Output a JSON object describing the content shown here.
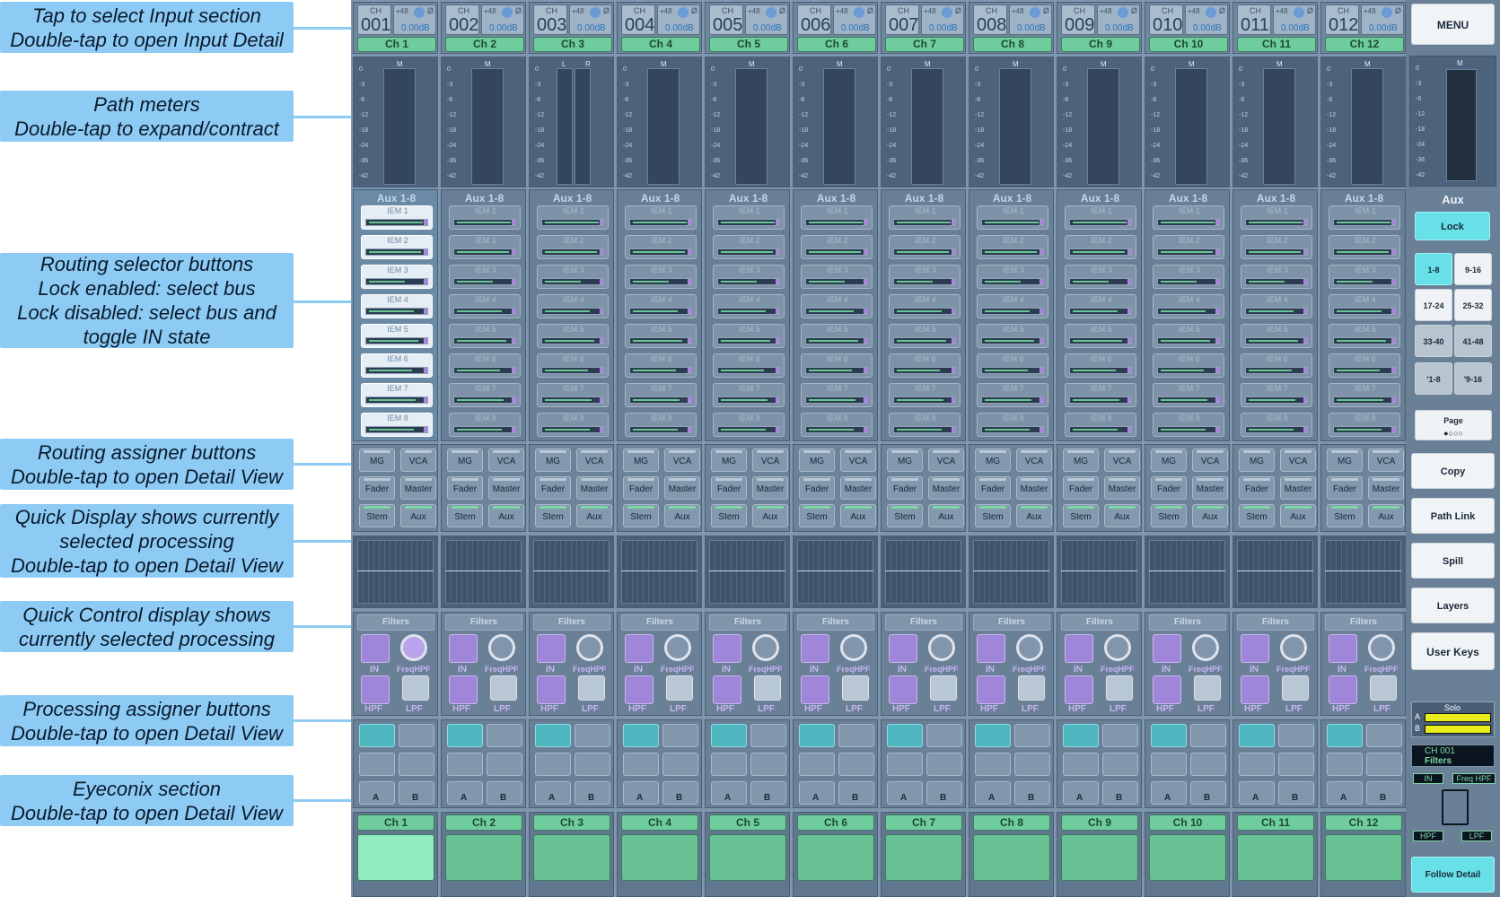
{
  "callouts": [
    {
      "lines": [
        "Tap to select Input section",
        "Double-tap to open Input Detail"
      ]
    },
    {
      "lines": [
        "Path meters",
        "Double-tap to expand/contract"
      ]
    },
    {
      "lines": [
        "Routing selector buttons",
        "Lock enabled: select bus",
        "Lock disabled: select bus and",
        "toggle IN state"
      ]
    },
    {
      "lines": [
        "Routing assigner buttons",
        "Double-tap to open Detail View"
      ]
    },
    {
      "lines": [
        "Quick Display shows currently",
        "selected processing",
        "Double-tap to open Detail View"
      ]
    },
    {
      "lines": [
        "Quick Control display shows",
        "currently selected processing"
      ]
    },
    {
      "lines": [
        "Processing assigner buttons",
        "Double-tap to open Detail View"
      ]
    },
    {
      "lines": [
        "Eyeconix section",
        "Double-tap to open Detail View"
      ]
    }
  ],
  "strip_common": {
    "ch_label": "CH",
    "p48": "+48",
    "phase": "Ø",
    "gain": "0.00dB",
    "meter_mono": "M",
    "meter_l": "L",
    "meter_r": "R",
    "scale": [
      "0",
      "-3",
      "-6",
      "-12",
      "-18",
      "-24",
      "-36",
      "-42"
    ],
    "aux_title": "Aux 1-8",
    "iem": [
      "IEM 1",
      "IEM 2",
      "IEM 3",
      "IEM 4",
      "IEM 5",
      "IEM 6",
      "IEM 7",
      "IEM 8"
    ],
    "assign": [
      "MG",
      "VCA",
      "Fader",
      "Master",
      "Stem",
      "Aux"
    ],
    "filters": "Filters",
    "in": "IN",
    "freq": "FreqHPF",
    "hpf": "HPF",
    "lpf": "LPF",
    "a": "A",
    "b": "B"
  },
  "strips": [
    {
      "num": "001",
      "name": "Ch 1"
    },
    {
      "num": "002",
      "name": "Ch 2"
    },
    {
      "num": "003",
      "name": "Ch 3"
    },
    {
      "num": "004",
      "name": "Ch 4"
    },
    {
      "num": "005",
      "name": "Ch 5"
    },
    {
      "num": "006",
      "name": "Ch 6"
    },
    {
      "num": "007",
      "name": "Ch 7"
    },
    {
      "num": "008",
      "name": "Ch 8"
    },
    {
      "num": "009",
      "name": "Ch 9"
    },
    {
      "num": "010",
      "name": "Ch 10"
    },
    {
      "num": "011",
      "name": "Ch 11"
    },
    {
      "num": "012",
      "name": "Ch 12"
    }
  ],
  "right": {
    "menu": "MENU",
    "meter_label": "M",
    "aux": "Aux",
    "lock": "Lock",
    "banks": [
      "1-8",
      "9-16",
      "17-24",
      "25-32",
      "33-40",
      "41-48",
      "'1-8",
      "'9-16"
    ],
    "page": "Page",
    "page_dots": "●○○○",
    "copy": "Copy",
    "path_link": "Path Link",
    "spill": "Spill",
    "layers": "Layers",
    "user_keys": "User Keys",
    "solo": "Solo",
    "solo_a": "A",
    "solo_b": "B",
    "sel_ch": "CH 001",
    "sel_proc": "Filters",
    "in": "IN",
    "freq": "Freq HPF",
    "hpf": "HPF",
    "lpf": "LPF",
    "follow": "Follow Detail"
  },
  "colors": {
    "accent_cyan": "#67e0e8",
    "channel_green": "#6fcc9d",
    "purple": "#a689d6",
    "callout": "#8dcbf5"
  }
}
